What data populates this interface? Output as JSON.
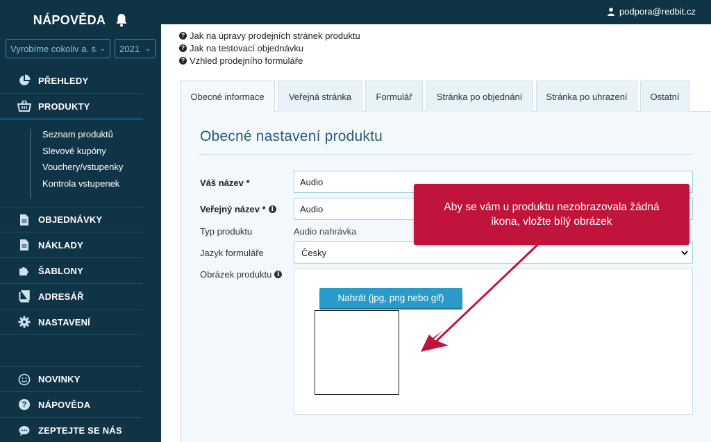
{
  "sidebar": {
    "title": "NÁPOVĚDA",
    "company_select": "Vyrobíme cokoliv a. s.",
    "year_select": "2021",
    "menu": [
      {
        "label": "PŘEHLEDY",
        "icon": "pie-chart-icon"
      },
      {
        "label": "PRODUKTY",
        "icon": "basket-icon"
      }
    ],
    "submenu": [
      "Seznam produktů",
      "Slevové kupóny",
      "Vouchery/vstupenky",
      "Kontrola vstupenek"
    ],
    "menu2": [
      {
        "label": "OBJEDNÁVKY",
        "icon": "document-icon"
      },
      {
        "label": "NÁKLADY",
        "icon": "document-icon"
      },
      {
        "label": "ŠABLONY",
        "icon": "puzzle-icon"
      },
      {
        "label": "ADRESÁŘ",
        "icon": "book-icon"
      },
      {
        "label": "NASTAVENÍ",
        "icon": "gear-icon"
      }
    ],
    "bottom": [
      {
        "label": "NOVINKY",
        "icon": "smile-icon"
      },
      {
        "label": "NÁPOVĚDA",
        "icon": "question-icon"
      },
      {
        "label": "ZEPTEJTE SE NÁS",
        "icon": "chat-icon"
      }
    ]
  },
  "topbar": {
    "user_email": "podpora@redbit.cz"
  },
  "help_links": [
    "Jak na úpravy prodejních stránek produktu",
    "Jak na testovací objednávku",
    "Vzhled prodejního formuláře"
  ],
  "tabs": [
    "Obecné informace",
    "Veřejná stránka",
    "Formulář",
    "Stránka po objednání",
    "Stránka po uhrazení",
    "Ostatní"
  ],
  "panel": {
    "heading": "Obecné nastavení produktu",
    "your_name_label": "Váš název *",
    "your_name_value": "Audio",
    "public_name_label": "Veřejný název *",
    "public_name_value": "Audio",
    "type_label": "Typ produktu",
    "type_value": "Audio nahrávka",
    "lang_label": "Jazyk formuláře",
    "lang_value": "Česky",
    "image_label": "Obrázek produktu",
    "upload_label": "Nahrát (jpg, png nebo gif)"
  },
  "callout": {
    "text": "Aby se vám u produktu nezobrazovala žádná ikona, vložte bílý obrázek"
  },
  "colors": {
    "sidebar_bg": "#0f3446",
    "accent": "#2a9ac9",
    "callout": "#c0143c"
  }
}
